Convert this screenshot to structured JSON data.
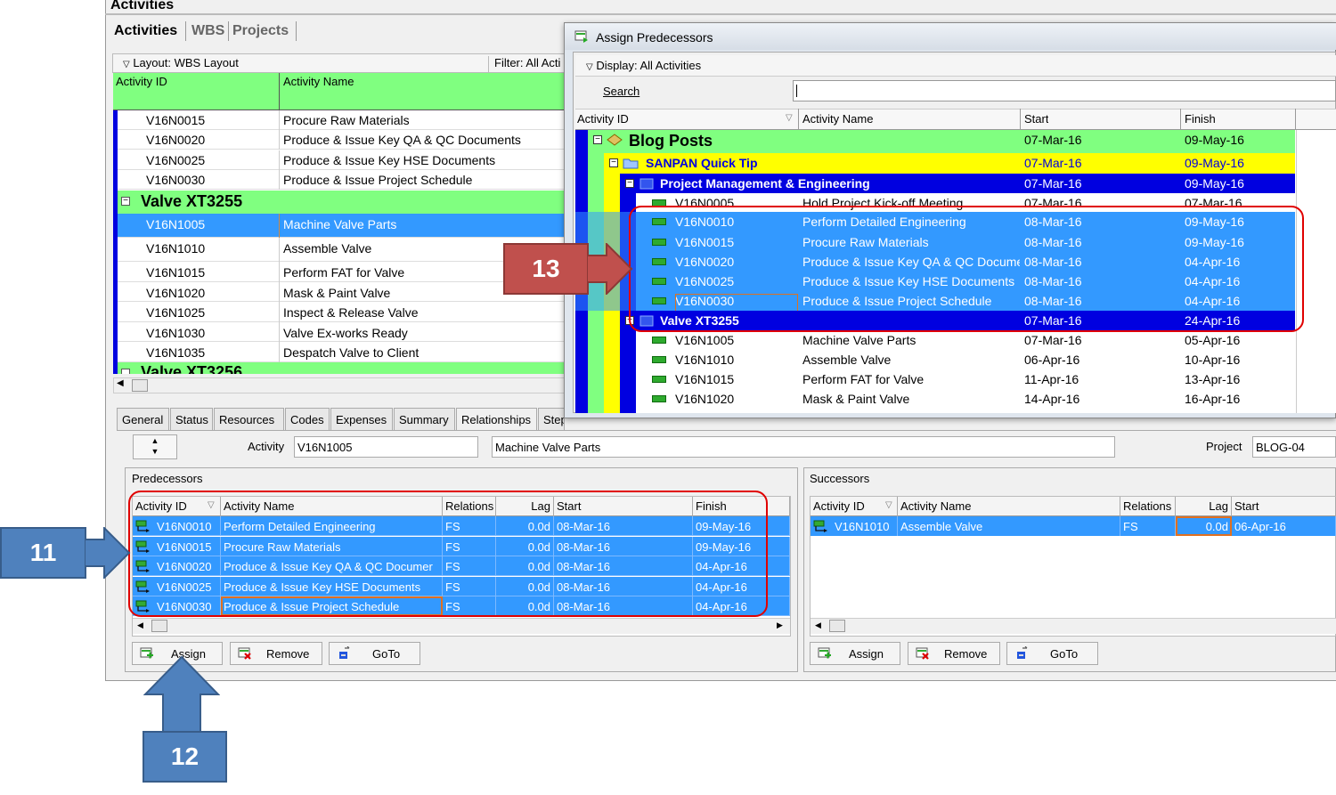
{
  "main": {
    "title": "Activities",
    "tabs": [
      "Activities",
      "WBS",
      "Projects"
    ],
    "layout_label": "Layout: WBS Layout",
    "filter_label": "Filter: All Acti",
    "columns": [
      "Activity ID",
      "Activity Name"
    ],
    "rows": [
      {
        "id": "V16N0015",
        "name": "Procure Raw Materials"
      },
      {
        "id": "V16N0020",
        "name": "Produce & Issue Key QA & QC Documents"
      },
      {
        "id": "V16N0025",
        "name": "Produce & Issue Key HSE Documents"
      },
      {
        "id": "V16N0030",
        "name": "Produce & Issue Project Schedule"
      }
    ],
    "group": "Valve XT3255",
    "rows2": [
      {
        "id": "V16N1005",
        "name": "Machine Valve Parts"
      },
      {
        "id": "V16N1010",
        "name": "Assemble Valve"
      },
      {
        "id": "V16N1015",
        "name": "Perform FAT for Valve"
      },
      {
        "id": "V16N1020",
        "name": "Mask & Paint Valve"
      },
      {
        "id": "V16N1025",
        "name": "Inspect & Release Valve"
      },
      {
        "id": "V16N1030",
        "name": "Valve Ex-works Ready"
      },
      {
        "id": "V16N1035",
        "name": "Despatch Valve to Client"
      }
    ],
    "group2_partial": "Valve XT3256"
  },
  "details": {
    "tabs": [
      "General",
      "Status",
      "Resources",
      "Codes",
      "Expenses",
      "Summary",
      "Relationships",
      "Step"
    ],
    "activity_label": "Activity",
    "activity_id": "V16N1005",
    "activity_name": "Machine Valve Parts",
    "project_label": "Project",
    "project_value": "BLOG-04",
    "predecessors": {
      "title": "Predecessors",
      "columns": [
        "Activity ID",
        "Activity Name",
        "Relations",
        "Lag",
        "Start",
        "Finish"
      ],
      "rows": [
        {
          "id": "V16N0010",
          "name": "Perform Detailed Engineering",
          "rel": "FS",
          "lag": "0.0d",
          "start": "08-Mar-16",
          "finish": "09-May-16"
        },
        {
          "id": "V16N0015",
          "name": "Procure Raw Materials",
          "rel": "FS",
          "lag": "0.0d",
          "start": "08-Mar-16",
          "finish": "09-May-16"
        },
        {
          "id": "V16N0020",
          "name": "Produce & Issue Key QA & QC Documer",
          "rel": "FS",
          "lag": "0.0d",
          "start": "08-Mar-16",
          "finish": "04-Apr-16"
        },
        {
          "id": "V16N0025",
          "name": "Produce & Issue Key HSE Documents",
          "rel": "FS",
          "lag": "0.0d",
          "start": "08-Mar-16",
          "finish": "04-Apr-16"
        },
        {
          "id": "V16N0030",
          "name": "Produce & Issue Project Schedule",
          "rel": "FS",
          "lag": "0.0d",
          "start": "08-Mar-16",
          "finish": "04-Apr-16"
        }
      ]
    },
    "successors": {
      "title": "Successors",
      "columns": [
        "Activity ID",
        "Activity Name",
        "Relations",
        "Lag",
        "Start"
      ],
      "rows": [
        {
          "id": "V16N1010",
          "name": "Assemble Valve",
          "rel": "FS",
          "lag": "0.0d",
          "start": "06-Apr-16"
        }
      ]
    },
    "buttons": {
      "assign": "Assign",
      "remove": "Remove",
      "goto": "GoTo"
    }
  },
  "dialog": {
    "title": "Assign Predecessors",
    "display_label": "Display: All Activities",
    "search_label": "Search",
    "search_value": "",
    "columns": [
      "Activity ID",
      "Activity Name",
      "Start",
      "Finish"
    ],
    "rows": [
      {
        "kind": "project",
        "name": "Blog Posts",
        "start": "07-Mar-16",
        "finish": "09-May-16"
      },
      {
        "kind": "wbs1",
        "name": "SANPAN Quick Tip",
        "start": "07-Mar-16",
        "finish": "09-May-16"
      },
      {
        "kind": "wbs2",
        "name": "Project Management & Engineering",
        "start": "07-Mar-16",
        "finish": "09-May-16"
      },
      {
        "kind": "act",
        "id": "V16N0005",
        "name": "Hold Project Kick-off Meeting",
        "start": "07-Mar-16",
        "finish": "07-Mar-16"
      },
      {
        "kind": "sel",
        "id": "V16N0010",
        "name": "Perform Detailed Engineering",
        "start": "08-Mar-16",
        "finish": "09-May-16"
      },
      {
        "kind": "sel",
        "id": "V16N0015",
        "name": "Procure Raw Materials",
        "start": "08-Mar-16",
        "finish": "09-May-16"
      },
      {
        "kind": "sel",
        "id": "V16N0020",
        "name": "Produce & Issue Key QA & QC Documen",
        "start": "08-Mar-16",
        "finish": "04-Apr-16"
      },
      {
        "kind": "sel",
        "id": "V16N0025",
        "name": "Produce & Issue Key HSE Documents",
        "start": "08-Mar-16",
        "finish": "04-Apr-16"
      },
      {
        "kind": "sel",
        "id": "V16N0030",
        "name": "Produce & Issue Project Schedule",
        "start": "08-Mar-16",
        "finish": "04-Apr-16"
      },
      {
        "kind": "wbs2",
        "name": "Valve XT3255",
        "start": "07-Mar-16",
        "finish": "24-Apr-16"
      },
      {
        "kind": "act",
        "id": "V16N1005",
        "name": "Machine Valve Parts",
        "start": "07-Mar-16",
        "finish": "05-Apr-16"
      },
      {
        "kind": "act",
        "id": "V16N1010",
        "name": "Assemble Valve",
        "start": "06-Apr-16",
        "finish": "10-Apr-16"
      },
      {
        "kind": "act",
        "id": "V16N1015",
        "name": "Perform FAT for Valve",
        "start": "11-Apr-16",
        "finish": "13-Apr-16"
      },
      {
        "kind": "act",
        "id": "V16N1020",
        "name": "Mask & Paint Valve",
        "start": "14-Apr-16",
        "finish": "16-Apr-16"
      }
    ]
  },
  "callouts": {
    "c11": "11",
    "c12": "12",
    "c13": "13"
  },
  "colors": {
    "green": "#80ff80",
    "blue": "#3399ff",
    "navy": "#0000e0",
    "yellow": "#ffff00",
    "highlight_red": "#e00000",
    "callout_blue": "#4f81bd",
    "callout_red": "#c0504d"
  }
}
